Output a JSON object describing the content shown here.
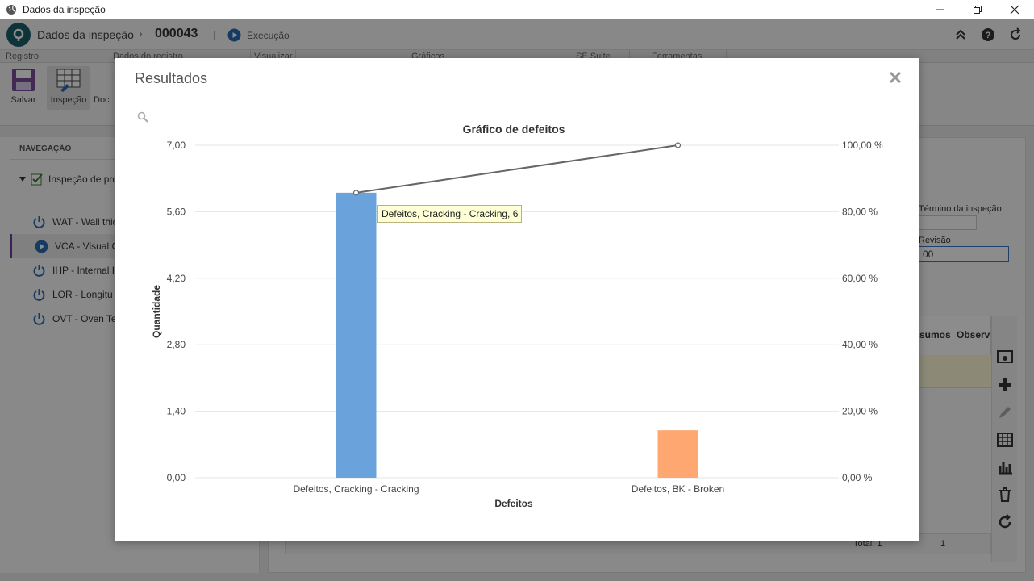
{
  "window": {
    "title": "Dados da inspeção"
  },
  "header": {
    "title": "Dados da inspeção",
    "separator": "›",
    "record_id": "000043",
    "divider": "|",
    "status": "Execução"
  },
  "tabs": [
    "Registro",
    "Dados do registro",
    "Visualizar",
    "Gráficos",
    "SE Suite",
    "Ferramentas"
  ],
  "ribbon": {
    "save_label": "Salvar",
    "inspection_label": "Inspeção",
    "doc_label": "Doc"
  },
  "navigation": {
    "heading": "NAVEGAÇÃO",
    "root_label": "Inspeção de pro",
    "items": [
      {
        "label": "WAT - Wall thic"
      },
      {
        "label": "VCA - Visual C"
      },
      {
        "label": "IHP - Internal I"
      },
      {
        "label": "LOR - Longitu"
      },
      {
        "label": "OVT - Oven Te"
      }
    ]
  },
  "background_peek": {
    "end_label": "Término da inspeção",
    "revision_label": "Revisão",
    "revision_value": "00",
    "col1": "sumos",
    "col2": "Observ",
    "total": "Total: 1",
    "page": "1"
  },
  "modal": {
    "title": "Resultados"
  },
  "tooltip": {
    "text": "Defeitos, Cracking - Cracking, 6"
  },
  "colors": {
    "bar_1": "#6aa3dc",
    "bar_2": "#ffa771",
    "line": "#666666",
    "accent_nav": "#6a3fa0",
    "logo": "#1a5f6a"
  },
  "chart_data": {
    "type": "bar",
    "title": "Gráfico de defeitos",
    "xlabel": "Defeitos",
    "ylabel": "Quantidade",
    "categories": [
      "Defeitos, Cracking - Cracking",
      "Defeitos, BK - Broken"
    ],
    "values": [
      6,
      1
    ],
    "bar_colors": [
      "#6aa3dc",
      "#ffa771"
    ],
    "ylim": [
      0,
      7
    ],
    "y_ticks": [
      "0,00",
      "1,40",
      "2,80",
      "4,20",
      "5,60",
      "7,00"
    ],
    "y_tick_values": [
      0,
      1.4,
      2.8,
      4.2,
      5.6,
      7
    ],
    "y2_ticks": [
      "0,00 %",
      "20,00 %",
      "40,00 %",
      "60,00 %",
      "80,00 %",
      "100,00 %"
    ],
    "y2_tick_values": [
      0,
      20,
      40,
      60,
      80,
      100
    ],
    "y2lim": [
      0,
      100
    ],
    "cumulative_percent": [
      85.71,
      100
    ],
    "grid": true
  }
}
